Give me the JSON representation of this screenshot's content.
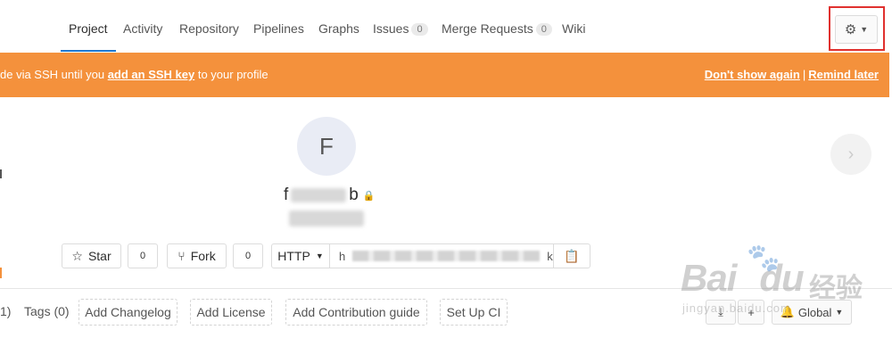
{
  "nav": {
    "items": [
      {
        "label": "Project",
        "active": true
      },
      {
        "label": "Activity"
      },
      {
        "label": "Repository"
      },
      {
        "label": "Pipelines"
      },
      {
        "label": "Graphs"
      },
      {
        "label": "Issues",
        "count": "0"
      },
      {
        "label": "Merge Requests",
        "count": "0"
      },
      {
        "label": "Wiki"
      }
    ],
    "settings_icon": "gear-icon",
    "settings_caret_icon": "caret-down-icon"
  },
  "alert": {
    "prefix": "de via SSH until you ",
    "link": "add an SSH key",
    "suffix": " to your profile",
    "dont_show": "Don't show again",
    "separator": "|",
    "remind": "Remind later",
    "color": "#f4913c"
  },
  "project": {
    "avatar_letter": "F",
    "name_start": "f",
    "name_end": "b",
    "visibility_icon": "lock-icon"
  },
  "actions": {
    "star_label": "Star",
    "star_count": "0",
    "fork_label": "Fork",
    "fork_count": "0",
    "protocol": "HTTP",
    "url_start": "h",
    "url_end": "k",
    "copy_icon": "clipboard-icon"
  },
  "footer": {
    "branches_tail": "1)",
    "tags": "Tags (0)",
    "add_changelog": "Add Changelog",
    "add_license": "Add License",
    "add_contribution": "Add Contribution guide",
    "setup_ci": "Set Up CI",
    "notification_level": "Global"
  },
  "watermark": {
    "brand": "Bai",
    "brand_end": "du",
    "cn": "经验",
    "domain": "jingyan.baidu.com"
  }
}
